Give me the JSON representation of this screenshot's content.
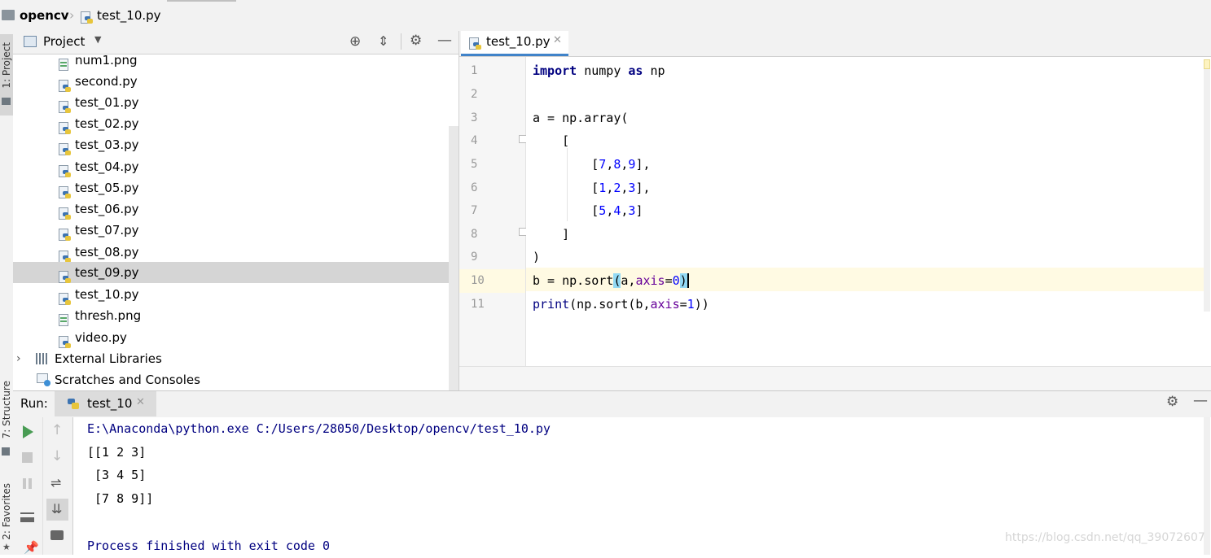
{
  "breadcrumb": {
    "project": "opencv",
    "file": "test_10.py"
  },
  "side_strip": {
    "project_tab": "1: Project",
    "structure_tab": "7: Structure",
    "favorites_tab": "2: Favorites"
  },
  "project_panel": {
    "title": "Project",
    "files": [
      {
        "name": "num1.png",
        "type": "png"
      },
      {
        "name": "second.py",
        "type": "py"
      },
      {
        "name": "test_01.py",
        "type": "py"
      },
      {
        "name": "test_02.py",
        "type": "py"
      },
      {
        "name": "test_03.py",
        "type": "py"
      },
      {
        "name": "test_04.py",
        "type": "py"
      },
      {
        "name": "test_05.py",
        "type": "py"
      },
      {
        "name": "test_06.py",
        "type": "py"
      },
      {
        "name": "test_07.py",
        "type": "py"
      },
      {
        "name": "test_08.py",
        "type": "py"
      },
      {
        "name": "test_09.py",
        "type": "py",
        "selected": true
      },
      {
        "name": "test_10.py",
        "type": "py"
      },
      {
        "name": "thresh.png",
        "type": "png"
      },
      {
        "name": "video.py",
        "type": "py"
      }
    ],
    "external_libraries": "External Libraries",
    "scratches": "Scratches and Consoles"
  },
  "editor": {
    "tab_label": "test_10.py",
    "line_numbers": [
      "1",
      "2",
      "3",
      "4",
      "5",
      "6",
      "7",
      "8",
      "9",
      "10",
      "11"
    ],
    "current_line": "10"
  },
  "run_panel": {
    "label": "Run:",
    "tab_label": "test_10",
    "output": [
      "E:\\Anaconda\\python.exe C:/Users/28050/Desktop/opencv/test_10.py",
      "[[1 2 3]",
      " [3 4 5]",
      " [7 8 9]]",
      "",
      "Process finished with exit code 0"
    ],
    "watermark": "https://blog.csdn.net/qq_39072607"
  },
  "colors": {
    "keyword": "#000080",
    "number": "#0000ff",
    "param": "#660099",
    "console_text": "#000080",
    "current_line_bg": "#fffae3"
  }
}
